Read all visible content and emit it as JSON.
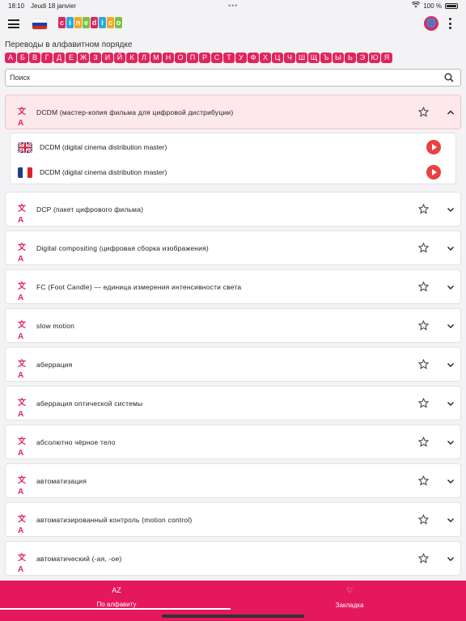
{
  "status": {
    "time": "18:10",
    "date": "Jeudi 18 janvier",
    "battery": "100 %"
  },
  "header": {
    "logo_letters": [
      "c",
      "i",
      "n",
      "e",
      "d",
      "i",
      "c",
      "o"
    ],
    "logo_colors": [
      "#e0245e",
      "#2aa9e0",
      "#f5a623",
      "#7ac143",
      "#e0245e",
      "#2aa9e0",
      "#f5a623",
      "#7ac143"
    ],
    "accent": "#e0245e"
  },
  "section_title": "Переводы в алфавитном порядке",
  "alphabet": [
    "А",
    "Б",
    "В",
    "Г",
    "Д",
    "Е",
    "Ж",
    "З",
    "И",
    "Й",
    "К",
    "Л",
    "М",
    "Н",
    "О",
    "П",
    "Р",
    "С",
    "Т",
    "У",
    "Ф",
    "Х",
    "Ц",
    "Ч",
    "Ш",
    "Щ",
    "Ъ",
    "Ы",
    "Ь",
    "Э",
    "Ю",
    "Я"
  ],
  "search": {
    "placeholder": "Поиск"
  },
  "expanded": {
    "term": "DCDM (мастер-копия фильма для цифровой дистрибуции)",
    "translations": [
      {
        "lang_icon": "flag-uk-icon",
        "text": "DCDM (digital cinema distribution master)"
      },
      {
        "lang_icon": "flag-fr-icon",
        "text": "DCDM (digital cinema distribution master)"
      }
    ]
  },
  "terms": [
    "DCP (пакет цифрового фильма)",
    "Digital compositing (цифровая сборка изображения)",
    "FC (Foot Candle) — единица измерения интенсивности света",
    "slow motion",
    "аберрация",
    "аберрация оптической системы",
    "абсолютно чёрное тело",
    "автоматизация",
    "автоматизированный контроль (motion control)",
    "автоматический (-ая, -ое)"
  ],
  "tabs": [
    {
      "icon": "AZ",
      "label": "По алфавиту"
    },
    {
      "icon": "♡",
      "label": "Закладка"
    }
  ]
}
